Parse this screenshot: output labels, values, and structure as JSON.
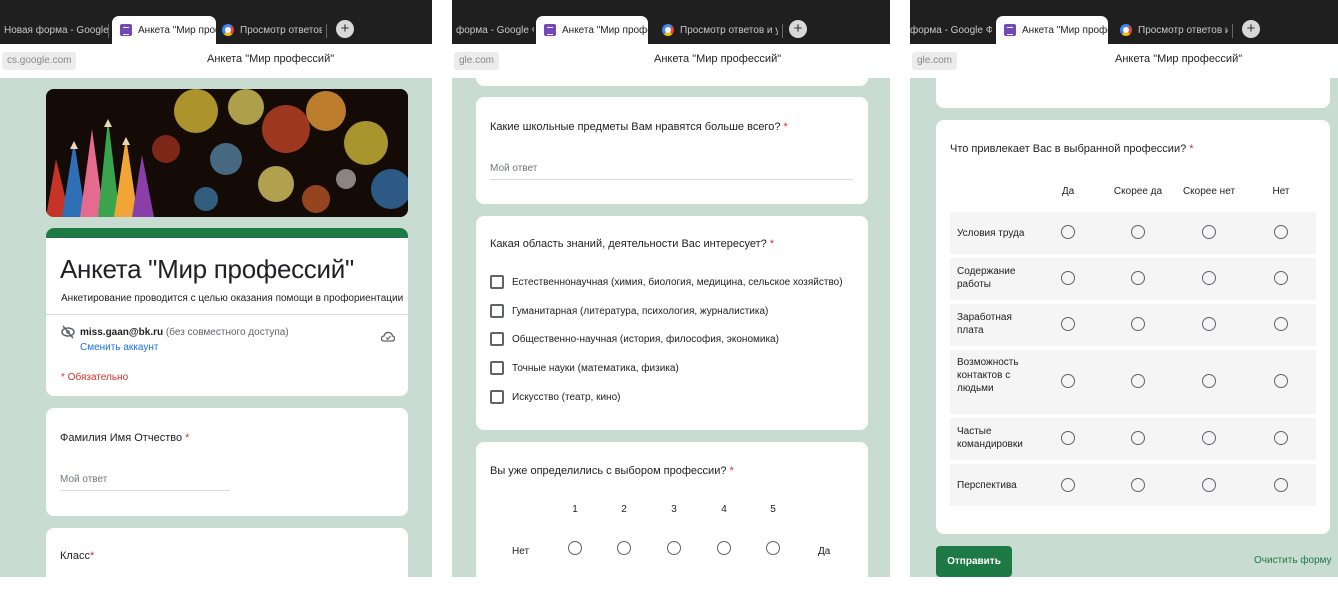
{
  "browser": {
    "tab_new_form": "Новая форма - Google Ф",
    "tab_new_form_short": "форма - Google Фо",
    "tab_survey": "Анкета \"Мир професси",
    "tab_responses": "Просмотр ответов и упра",
    "close_glyph": "✕",
    "newtab_glyph": "+",
    "url_p1": "cs.google.com",
    "url_p2": "gle.com",
    "url_p3": "gle.com",
    "page_title": "Анкета \"Мир профессий\""
  },
  "form": {
    "title": "Анкета \"Мир профессий\"",
    "description": "Анкетирование проводится с целью оказания помощи в профориентации",
    "account_email": "miss.gaan@bk.ru",
    "account_note": "(без совместного доступа)",
    "switch_account": "Сменить аккаунт",
    "required_note": "* Обязательно"
  },
  "questions": {
    "fio": {
      "label": "Фамилия Имя Отчество",
      "placeholder": "Мой ответ"
    },
    "class": {
      "label": "Класс"
    },
    "subjects": {
      "label": "Какие школьные предметы Вам нравятся больше всего?",
      "placeholder": "Мой ответ"
    },
    "areas": {
      "label": "Какая область знаний, деятельности Вас интересует?",
      "options": [
        "Естественнонаучная (химия, биология, медицина, сельское хозяйство)",
        "Гуманитарная (литература, психология, журналистика)",
        "Общественно-научная (история, философия, экономика)",
        "Точные науки (математика, физика)",
        "Искусство (театр, кино)"
      ]
    },
    "decided": {
      "label": "Вы уже определились с выбором профессии?",
      "scale": [
        "1",
        "2",
        "3",
        "4",
        "5"
      ],
      "low_label": "Нет",
      "high_label": "Да"
    },
    "attracts": {
      "label": "Что привлекает Вас в выбранной профессии?",
      "columns": [
        "Да",
        "Скорее да",
        "Скорее нет",
        "Нет"
      ],
      "rows": [
        "Условия труда",
        "Содержание работы",
        "Заработная плата",
        "Возможность контактов с людьми",
        "Частые командировки",
        "Перспектива"
      ]
    }
  },
  "required_mark": "*",
  "buttons": {
    "submit": "Отправить",
    "clear": "Очистить форму"
  },
  "colors": {
    "accent": "#1e7a45",
    "page_bg": "#c8dcd1",
    "forms_purple": "#7248b9",
    "required": "#d93025"
  }
}
